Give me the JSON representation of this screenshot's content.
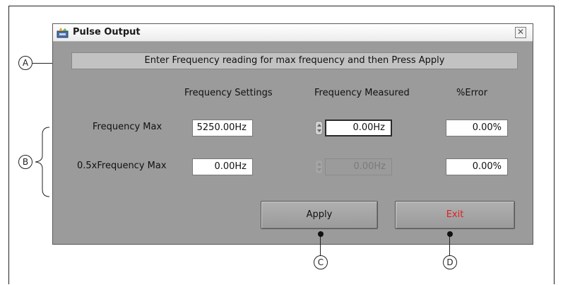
{
  "window": {
    "title": "Pulse Output",
    "close_icon": "close-icon"
  },
  "message": "Enter Frequency reading for max frequency and then Press Apply",
  "headers": {
    "settings": "Frequency Settings",
    "measured": "Frequency Measured",
    "error": "%Error"
  },
  "rows": [
    {
      "label": "Frequency Max",
      "setting": "5250.00Hz",
      "measured": "0.00Hz",
      "error": "0.00%"
    },
    {
      "label": "0.5xFrequency Max",
      "setting": "0.00Hz",
      "measured": "0.00Hz",
      "error": "0.00%"
    }
  ],
  "buttons": {
    "apply": "Apply",
    "exit": "Exit",
    "exit_color": "#e02020"
  },
  "callouts": {
    "a": "A",
    "b": "B",
    "c": "C",
    "d": "D"
  },
  "colors": {
    "panel": "#9b9b9b",
    "message_bar": "#c2c2c2"
  }
}
